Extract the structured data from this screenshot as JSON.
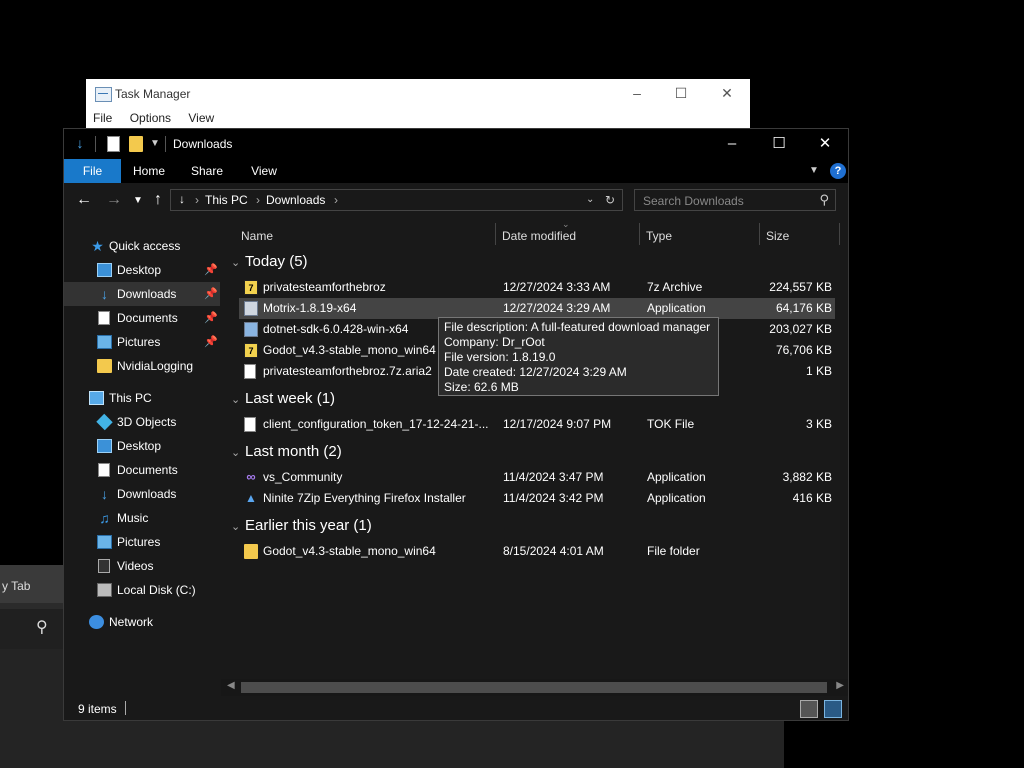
{
  "background_window": {
    "tab_label": "y Tab",
    "search_icon": "search-icon"
  },
  "task_manager": {
    "title": "Task Manager",
    "menu": [
      "File",
      "Options",
      "View"
    ]
  },
  "explorer": {
    "title": "Downloads",
    "ribbon_tabs": [
      "File",
      "Home",
      "Share",
      "View"
    ],
    "address": {
      "crumbs": [
        "This PC",
        "Downloads"
      ]
    },
    "search": {
      "placeholder": "Search Downloads"
    },
    "nav": {
      "quick_access": "Quick access",
      "quick_items": [
        "Desktop",
        "Downloads",
        "Documents",
        "Pictures",
        "NvidiaLogging"
      ],
      "this_pc": "This PC",
      "pc_items": [
        "3D Objects",
        "Desktop",
        "Documents",
        "Downloads",
        "Music",
        "Pictures",
        "Videos",
        "Local Disk (C:)"
      ],
      "network": "Network"
    },
    "columns": [
      "Name",
      "Date modified",
      "Type",
      "Size"
    ],
    "groups": [
      {
        "label": "Today (5)",
        "files": [
          {
            "name": "privatesteamforthebroz",
            "date": "12/27/2024 3:33 AM",
            "type": "7z Archive",
            "size": "224,557 KB",
            "icon": "7z-archive-icon"
          },
          {
            "name": "Motrix-1.8.19-x64",
            "date": "12/27/2024 3:29 AM",
            "type": "Application",
            "size": "64,176 KB",
            "icon": "application-icon"
          },
          {
            "name": "dotnet-sdk-6.0.428-win-x64",
            "date": "",
            "type": "",
            "size": "203,027 KB",
            "icon": "installer-icon"
          },
          {
            "name": "Godot_v4.3-stable_mono_win64",
            "date": "",
            "type": "",
            "size": "76,706 KB",
            "icon": "7z-archive-icon"
          },
          {
            "name": "privatesteamforthebroz.7z.aria2",
            "date": "",
            "type": "",
            "size": "1 KB",
            "icon": "document-icon"
          }
        ]
      },
      {
        "label": "Last week (1)",
        "files": [
          {
            "name": "client_configuration_token_17-12-24-21-...",
            "date": "12/17/2024 9:07 PM",
            "type": "TOK File",
            "size": "3 KB",
            "icon": "document-icon"
          }
        ]
      },
      {
        "label": "Last month (2)",
        "files": [
          {
            "name": "vs_Community",
            "date": "11/4/2024 3:47 PM",
            "type": "Application",
            "size": "3,882 KB",
            "icon": "visual-studio-icon"
          },
          {
            "name": "Ninite 7Zip Everything Firefox Installer",
            "date": "11/4/2024 3:42 PM",
            "type": "Application",
            "size": "416 KB",
            "icon": "ninite-icon"
          }
        ]
      },
      {
        "label": "Earlier this year (1)",
        "files": [
          {
            "name": "Godot_v4.3-stable_mono_win64",
            "date": "8/15/2024 4:01 AM",
            "type": "File folder",
            "size": "",
            "icon": "folder-icon"
          }
        ]
      }
    ],
    "tooltip": {
      "description": "File description: A full-featured download manager",
      "company": "Company: Dr_rOot",
      "version": "File version: 1.8.19.0",
      "created": "Date created: 12/27/2024 3:29 AM",
      "size": "Size: 62.6 MB"
    },
    "status": {
      "count": "9 items"
    }
  }
}
